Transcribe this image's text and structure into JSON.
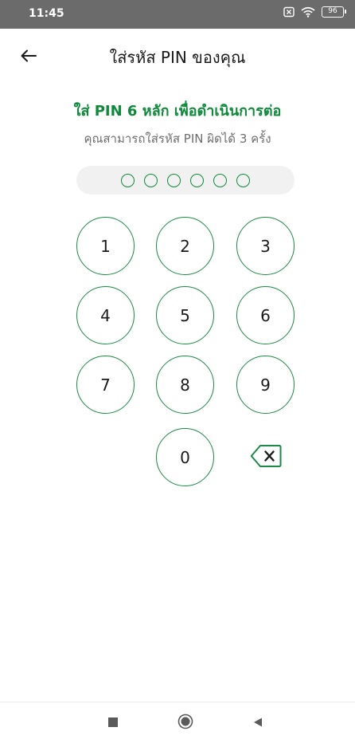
{
  "status_bar": {
    "time": "11:45",
    "battery": "96"
  },
  "app_bar": {
    "title": "ใส่รหัส PIN ของคุณ",
    "back_icon": "arrow-left-icon"
  },
  "prompt": {
    "heading": "ใส่ PIN 6 หลัก เพื่อดำเนินการต่อ",
    "subheading": "คุณสามารถใส่รหัส PIN ผิดได้ 3 ครั้ง"
  },
  "pin": {
    "length": 6,
    "filled": 0
  },
  "keypad": {
    "keys": [
      "1",
      "2",
      "3",
      "4",
      "5",
      "6",
      "7",
      "8",
      "9",
      "0"
    ],
    "delete_icon": "backspace-icon"
  },
  "nav": {
    "recents_icon": "square-icon",
    "home_icon": "circle-icon",
    "back_icon": "triangle-back-icon"
  },
  "colors": {
    "accent": "#0f8a3a",
    "key_border": "#1b8a44",
    "status_bar": "#6b6b6b",
    "pin_field_bg": "#f1f1f1"
  }
}
